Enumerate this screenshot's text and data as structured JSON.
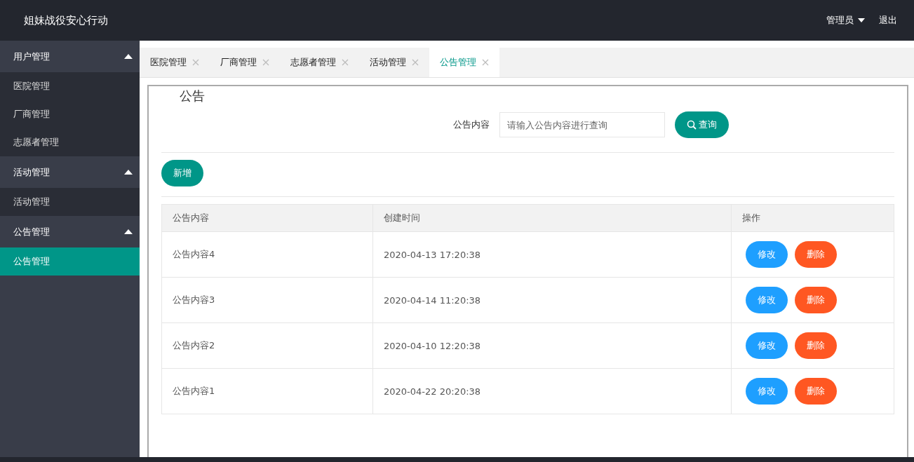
{
  "header": {
    "title": "姐妹战役安心行动",
    "user": "管理员",
    "logout": "退出"
  },
  "sidebar": [
    {
      "label": "用户管理",
      "expanded": true,
      "items": [
        {
          "label": "医院管理",
          "selected": false
        },
        {
          "label": "厂商管理",
          "selected": false
        },
        {
          "label": "志愿者管理",
          "selected": false
        }
      ]
    },
    {
      "label": "活动管理",
      "expanded": true,
      "items": [
        {
          "label": "活动管理",
          "selected": false
        }
      ]
    },
    {
      "label": "公告管理",
      "expanded": true,
      "items": [
        {
          "label": "公告管理",
          "selected": true
        }
      ]
    }
  ],
  "tabs": [
    {
      "label": "医院管理",
      "selected": false
    },
    {
      "label": "厂商管理",
      "selected": false
    },
    {
      "label": "志愿者管理",
      "selected": false
    },
    {
      "label": "活动管理",
      "selected": false
    },
    {
      "label": "公告管理",
      "selected": true
    }
  ],
  "panel": {
    "legend": "公告",
    "search_label": "公告内容",
    "search_placeholder": "请输入公告内容进行查询",
    "search_button": "查询",
    "add_button": "新增"
  },
  "table": {
    "columns": [
      "公告内容",
      "创建时间",
      "操作"
    ],
    "rows": [
      {
        "content": "公告内容4",
        "created": "2020-04-13 17:20:38",
        "actions": [
          "修改",
          "删除"
        ]
      },
      {
        "content": "公告内容3",
        "created": "2020-04-14 11:20:38",
        "actions": [
          "修改",
          "删除"
        ]
      },
      {
        "content": "公告内容2",
        "created": "2020-04-10 12:20:38",
        "actions": [
          "修改",
          "删除"
        ]
      },
      {
        "content": "公告内容1",
        "created": "2020-04-22 20:20:38",
        "actions": [
          "修改",
          "删除"
        ]
      }
    ]
  }
}
